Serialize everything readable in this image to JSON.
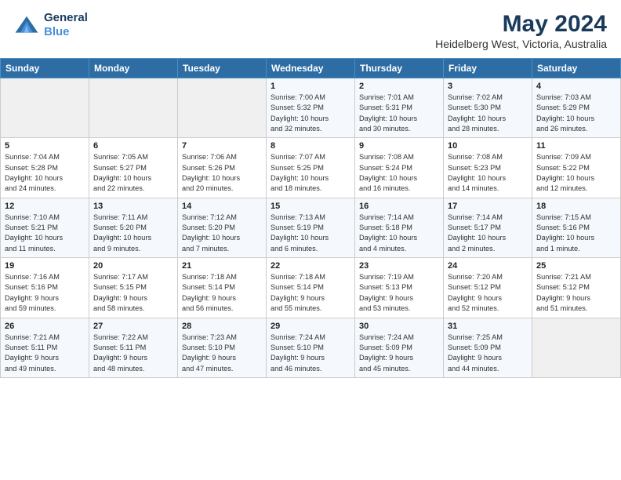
{
  "logo": {
    "line1": "General",
    "line2": "Blue"
  },
  "title": "May 2024",
  "subtitle": "Heidelberg West, Victoria, Australia",
  "header_days": [
    "Sunday",
    "Monday",
    "Tuesday",
    "Wednesday",
    "Thursday",
    "Friday",
    "Saturday"
  ],
  "weeks": [
    [
      {
        "day": "",
        "info": ""
      },
      {
        "day": "",
        "info": ""
      },
      {
        "day": "",
        "info": ""
      },
      {
        "day": "1",
        "info": "Sunrise: 7:00 AM\nSunset: 5:32 PM\nDaylight: 10 hours\nand 32 minutes."
      },
      {
        "day": "2",
        "info": "Sunrise: 7:01 AM\nSunset: 5:31 PM\nDaylight: 10 hours\nand 30 minutes."
      },
      {
        "day": "3",
        "info": "Sunrise: 7:02 AM\nSunset: 5:30 PM\nDaylight: 10 hours\nand 28 minutes."
      },
      {
        "day": "4",
        "info": "Sunrise: 7:03 AM\nSunset: 5:29 PM\nDaylight: 10 hours\nand 26 minutes."
      }
    ],
    [
      {
        "day": "5",
        "info": "Sunrise: 7:04 AM\nSunset: 5:28 PM\nDaylight: 10 hours\nand 24 minutes."
      },
      {
        "day": "6",
        "info": "Sunrise: 7:05 AM\nSunset: 5:27 PM\nDaylight: 10 hours\nand 22 minutes."
      },
      {
        "day": "7",
        "info": "Sunrise: 7:06 AM\nSunset: 5:26 PM\nDaylight: 10 hours\nand 20 minutes."
      },
      {
        "day": "8",
        "info": "Sunrise: 7:07 AM\nSunset: 5:25 PM\nDaylight: 10 hours\nand 18 minutes."
      },
      {
        "day": "9",
        "info": "Sunrise: 7:08 AM\nSunset: 5:24 PM\nDaylight: 10 hours\nand 16 minutes."
      },
      {
        "day": "10",
        "info": "Sunrise: 7:08 AM\nSunset: 5:23 PM\nDaylight: 10 hours\nand 14 minutes."
      },
      {
        "day": "11",
        "info": "Sunrise: 7:09 AM\nSunset: 5:22 PM\nDaylight: 10 hours\nand 12 minutes."
      }
    ],
    [
      {
        "day": "12",
        "info": "Sunrise: 7:10 AM\nSunset: 5:21 PM\nDaylight: 10 hours\nand 11 minutes."
      },
      {
        "day": "13",
        "info": "Sunrise: 7:11 AM\nSunset: 5:20 PM\nDaylight: 10 hours\nand 9 minutes."
      },
      {
        "day": "14",
        "info": "Sunrise: 7:12 AM\nSunset: 5:20 PM\nDaylight: 10 hours\nand 7 minutes."
      },
      {
        "day": "15",
        "info": "Sunrise: 7:13 AM\nSunset: 5:19 PM\nDaylight: 10 hours\nand 6 minutes."
      },
      {
        "day": "16",
        "info": "Sunrise: 7:14 AM\nSunset: 5:18 PM\nDaylight: 10 hours\nand 4 minutes."
      },
      {
        "day": "17",
        "info": "Sunrise: 7:14 AM\nSunset: 5:17 PM\nDaylight: 10 hours\nand 2 minutes."
      },
      {
        "day": "18",
        "info": "Sunrise: 7:15 AM\nSunset: 5:16 PM\nDaylight: 10 hours\nand 1 minute."
      }
    ],
    [
      {
        "day": "19",
        "info": "Sunrise: 7:16 AM\nSunset: 5:16 PM\nDaylight: 9 hours\nand 59 minutes."
      },
      {
        "day": "20",
        "info": "Sunrise: 7:17 AM\nSunset: 5:15 PM\nDaylight: 9 hours\nand 58 minutes."
      },
      {
        "day": "21",
        "info": "Sunrise: 7:18 AM\nSunset: 5:14 PM\nDaylight: 9 hours\nand 56 minutes."
      },
      {
        "day": "22",
        "info": "Sunrise: 7:18 AM\nSunset: 5:14 PM\nDaylight: 9 hours\nand 55 minutes."
      },
      {
        "day": "23",
        "info": "Sunrise: 7:19 AM\nSunset: 5:13 PM\nDaylight: 9 hours\nand 53 minutes."
      },
      {
        "day": "24",
        "info": "Sunrise: 7:20 AM\nSunset: 5:12 PM\nDaylight: 9 hours\nand 52 minutes."
      },
      {
        "day": "25",
        "info": "Sunrise: 7:21 AM\nSunset: 5:12 PM\nDaylight: 9 hours\nand 51 minutes."
      }
    ],
    [
      {
        "day": "26",
        "info": "Sunrise: 7:21 AM\nSunset: 5:11 PM\nDaylight: 9 hours\nand 49 minutes."
      },
      {
        "day": "27",
        "info": "Sunrise: 7:22 AM\nSunset: 5:11 PM\nDaylight: 9 hours\nand 48 minutes."
      },
      {
        "day": "28",
        "info": "Sunrise: 7:23 AM\nSunset: 5:10 PM\nDaylight: 9 hours\nand 47 minutes."
      },
      {
        "day": "29",
        "info": "Sunrise: 7:24 AM\nSunset: 5:10 PM\nDaylight: 9 hours\nand 46 minutes."
      },
      {
        "day": "30",
        "info": "Sunrise: 7:24 AM\nSunset: 5:09 PM\nDaylight: 9 hours\nand 45 minutes."
      },
      {
        "day": "31",
        "info": "Sunrise: 7:25 AM\nSunset: 5:09 PM\nDaylight: 9 hours\nand 44 minutes."
      },
      {
        "day": "",
        "info": ""
      }
    ]
  ]
}
